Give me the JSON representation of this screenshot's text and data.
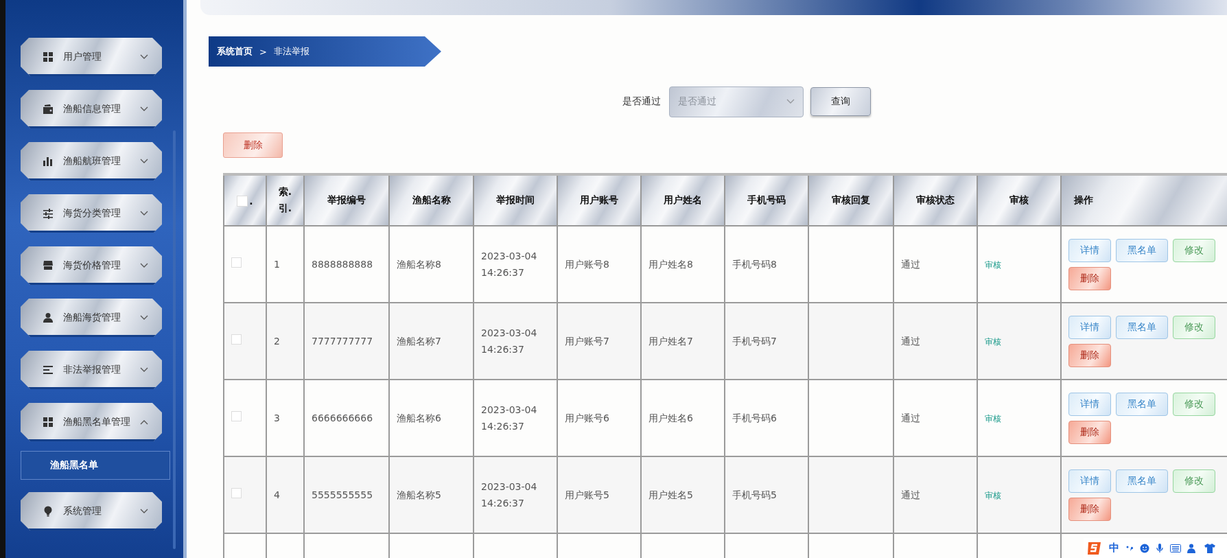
{
  "sidebar": {
    "menus": [
      {
        "label": "用户管理",
        "expanded": false
      },
      {
        "label": "渔船信息管理",
        "expanded": false
      },
      {
        "label": "渔船航班管理",
        "expanded": false
      },
      {
        "label": "海货分类管理",
        "expanded": false
      },
      {
        "label": "海货价格管理",
        "expanded": false
      },
      {
        "label": "渔船海货管理",
        "expanded": false
      },
      {
        "label": "非法举报管理",
        "expanded": false
      },
      {
        "label": "渔船黑名单管理",
        "expanded": true,
        "children": [
          {
            "label": "渔船黑名单",
            "selected": true
          }
        ]
      },
      {
        "label": "系统管理",
        "expanded": false
      }
    ]
  },
  "breadcrumb": {
    "home": "系统首页",
    "separator": ">",
    "current": "非法举报"
  },
  "filter": {
    "label": "是否通过",
    "select": {
      "placeholder": "是否通过"
    },
    "button": "查询"
  },
  "toolbar": {
    "delete_button": "删除"
  },
  "table": {
    "columns": [
      {
        "kind": "checkbox",
        "label": ".",
        "checked": false
      },
      {
        "kind": "index",
        "label": "索.引."
      },
      {
        "kind": "text",
        "label": "举报编号"
      },
      {
        "kind": "text",
        "label": "渔船名称"
      },
      {
        "kind": "text",
        "label": "举报时间"
      },
      {
        "kind": "text",
        "label": "用户账号"
      },
      {
        "kind": "text",
        "label": "用户姓名"
      },
      {
        "kind": "text",
        "label": "手机号码"
      },
      {
        "kind": "text",
        "label": "审核回复"
      },
      {
        "kind": "text",
        "label": "审核状态"
      },
      {
        "kind": "text",
        "label": "审核"
      },
      {
        "kind": "actions",
        "label": "操作"
      }
    ],
    "rows": [
      {
        "selected": false,
        "index": "1",
        "report_no": "8888888888",
        "ship": "渔船名称8",
        "time": "2023-03-04 14:26:37",
        "account": "用户账号8",
        "user_name": "用户姓名8",
        "phone": "手机号码8",
        "status": "通过",
        "review": "审核",
        "actions": [
          {
            "label": "详情",
            "kind": "info"
          },
          {
            "label": "黑名单",
            "kind": "info"
          },
          {
            "label": "修改",
            "kind": "success"
          },
          {
            "label": "删除",
            "kind": "danger"
          }
        ]
      },
      {
        "selected": false,
        "index": "2",
        "report_no": "7777777777",
        "ship": "渔船名称7",
        "time": "2023-03-04 14:26:37",
        "account": "用户账号7",
        "user_name": "用户姓名7",
        "phone": "手机号码7",
        "status": "通过",
        "review": "审核",
        "actions": [
          {
            "label": "详情",
            "kind": "info"
          },
          {
            "label": "黑名单",
            "kind": "info"
          },
          {
            "label": "修改",
            "kind": "success"
          },
          {
            "label": "删除",
            "kind": "danger"
          }
        ]
      },
      {
        "selected": false,
        "index": "3",
        "report_no": "6666666666",
        "ship": "渔船名称6",
        "time": "2023-03-04 14:26:37",
        "account": "用户账号6",
        "user_name": "用户姓名6",
        "phone": "手机号码6",
        "status": "通过",
        "review": "审核",
        "actions": [
          {
            "label": "详情",
            "kind": "info"
          },
          {
            "label": "黑名单",
            "kind": "info"
          },
          {
            "label": "修改",
            "kind": "success"
          },
          {
            "label": "删除",
            "kind": "danger"
          }
        ]
      },
      {
        "selected": false,
        "index": "4",
        "report_no": "5555555555",
        "ship": "渔船名称5",
        "time": "2023-03-04 14:26:37",
        "account": "用户账号5",
        "user_name": "用户姓名5",
        "phone": "手机号码5",
        "status": "通过",
        "review": "审核",
        "actions": [
          {
            "label": "详情",
            "kind": "info"
          },
          {
            "label": "黑名单",
            "kind": "info"
          },
          {
            "label": "修改",
            "kind": "success"
          },
          {
            "label": "删除",
            "kind": "danger"
          }
        ]
      }
    ]
  },
  "ime_toolbar": {
    "mode": "中"
  }
}
